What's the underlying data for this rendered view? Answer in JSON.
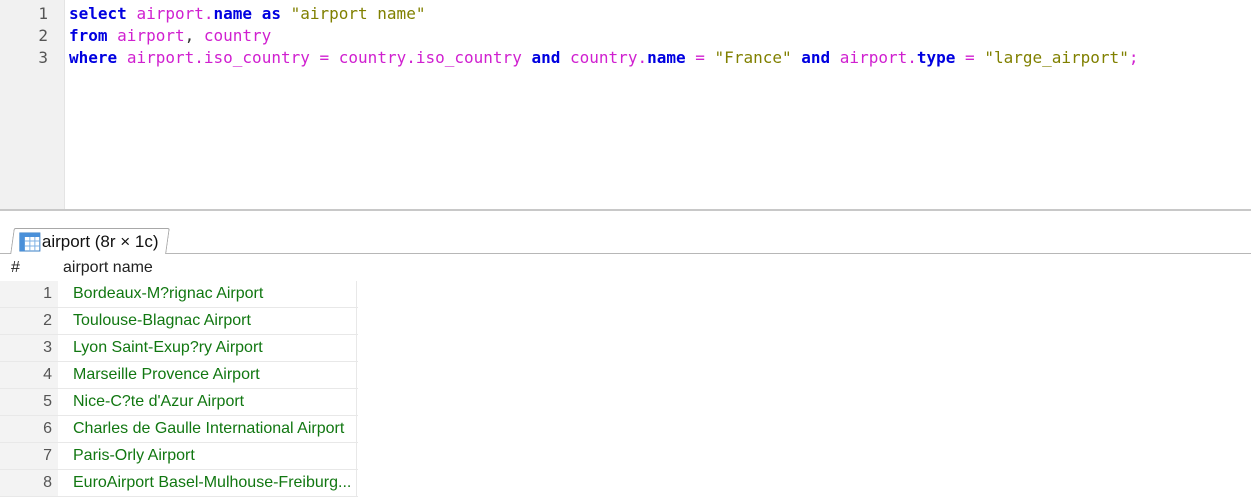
{
  "editor": {
    "line_numbers": [
      "1",
      "2",
      "3"
    ],
    "lines": [
      [
        {
          "t": "select",
          "c": "kw"
        },
        {
          "t": " ",
          "c": ""
        },
        {
          "t": "airport",
          "c": "tbl"
        },
        {
          "t": ".",
          "c": "op"
        },
        {
          "t": "name",
          "c": "col"
        },
        {
          "t": " ",
          "c": ""
        },
        {
          "t": "as",
          "c": "kw"
        },
        {
          "t": " ",
          "c": ""
        },
        {
          "t": "\"airport name\"",
          "c": "str"
        }
      ],
      [
        {
          "t": "from",
          "c": "kw"
        },
        {
          "t": " ",
          "c": ""
        },
        {
          "t": "airport",
          "c": "tbl"
        },
        {
          "t": ", ",
          "c": "punc"
        },
        {
          "t": "country",
          "c": "tbl"
        }
      ],
      [
        {
          "t": "where",
          "c": "kw"
        },
        {
          "t": " ",
          "c": ""
        },
        {
          "t": "airport",
          "c": "tbl"
        },
        {
          "t": ".",
          "c": "op"
        },
        {
          "t": "iso_country",
          "c": "tbl"
        },
        {
          "t": " ",
          "c": ""
        },
        {
          "t": "=",
          "c": "op"
        },
        {
          "t": " ",
          "c": ""
        },
        {
          "t": "country",
          "c": "tbl"
        },
        {
          "t": ".",
          "c": "op"
        },
        {
          "t": "iso_country",
          "c": "tbl"
        },
        {
          "t": " ",
          "c": ""
        },
        {
          "t": "and",
          "c": "kw"
        },
        {
          "t": " ",
          "c": ""
        },
        {
          "t": "country",
          "c": "tbl"
        },
        {
          "t": ".",
          "c": "op"
        },
        {
          "t": "name",
          "c": "col"
        },
        {
          "t": " ",
          "c": ""
        },
        {
          "t": "=",
          "c": "op"
        },
        {
          "t": " ",
          "c": ""
        },
        {
          "t": "\"France\"",
          "c": "str"
        },
        {
          "t": " ",
          "c": ""
        },
        {
          "t": "and",
          "c": "kw"
        },
        {
          "t": " ",
          "c": ""
        },
        {
          "t": "airport",
          "c": "tbl"
        },
        {
          "t": ".",
          "c": "op"
        },
        {
          "t": "type",
          "c": "col"
        },
        {
          "t": " ",
          "c": ""
        },
        {
          "t": "=",
          "c": "op"
        },
        {
          "t": " ",
          "c": ""
        },
        {
          "t": "\"large_airport\"",
          "c": "str"
        },
        {
          "t": ";",
          "c": "op"
        }
      ]
    ]
  },
  "result_tab": {
    "label": "airport (8r × 1c)",
    "icon": "table-grid-icon"
  },
  "grid": {
    "row_header": "#",
    "column": "airport name",
    "rows": [
      {
        "n": "1",
        "value": "Bordeaux-M?rignac Airport"
      },
      {
        "n": "2",
        "value": "Toulouse-Blagnac Airport"
      },
      {
        "n": "3",
        "value": "Lyon Saint-Exup?ry Airport"
      },
      {
        "n": "4",
        "value": "Marseille Provence Airport"
      },
      {
        "n": "5",
        "value": "Nice-C?te d'Azur Airport"
      },
      {
        "n": "6",
        "value": "Charles de Gaulle International Airport"
      },
      {
        "n": "7",
        "value": "Paris-Orly Airport"
      },
      {
        "n": "8",
        "value": "EuroAirport Basel-Mulhouse-Freiburg..."
      }
    ]
  },
  "colors": {
    "keyword": "#0000e0",
    "identifier": "#d020d0",
    "string": "#808000",
    "cell_text": "#117711"
  }
}
